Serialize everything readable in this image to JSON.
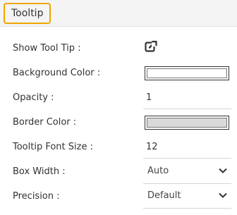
{
  "header": {
    "title": "Tooltip"
  },
  "rows": {
    "show_tooltip": {
      "label": "Show Tool Tip :",
      "icon": "external-link-icon"
    },
    "background_color": {
      "label": "Background Color :",
      "color": "#ffffff"
    },
    "opacity": {
      "label": "Opacity :",
      "value": "1"
    },
    "border_color": {
      "label": "Border Color :",
      "color": "#d9d9d9"
    },
    "tooltip_font_size": {
      "label": "Tooltip Font Size :",
      "value": "12"
    },
    "box_width": {
      "label": "Box Width :",
      "selected": "Auto"
    },
    "precision": {
      "label": "Precision :",
      "selected": "Default"
    }
  },
  "colors": {
    "accent": "#f0a500"
  }
}
